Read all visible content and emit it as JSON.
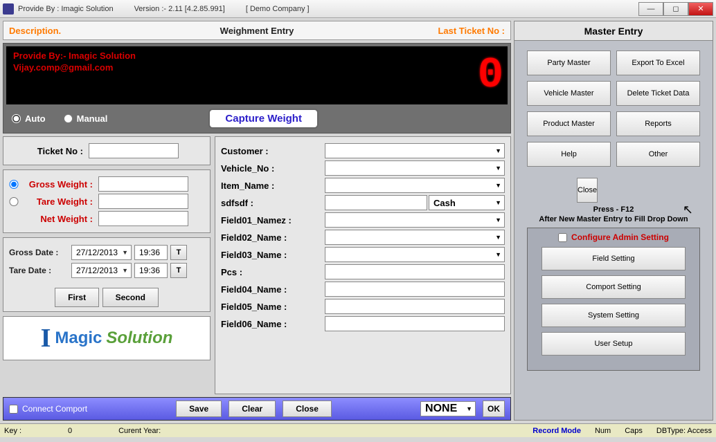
{
  "title": {
    "provider": "Provide By : Imagic Solution",
    "version": "Version :- 2.11 [4.2.85.991]",
    "company": "[ Demo Company ]"
  },
  "header": {
    "desc": "Description.",
    "title": "Weighment Entry",
    "last": "Last Ticket No :"
  },
  "display": {
    "line1": "Provide By:- Imagic Solution",
    "line2": "Vijay.comp@gmail.com",
    "digit": "0"
  },
  "mode": {
    "auto": "Auto",
    "manual": "Manual",
    "capture": "Capture Weight"
  },
  "left": {
    "ticket_lab": "Ticket No :",
    "ticket_val": "",
    "gross_lab": "Gross Weight :",
    "gross_val": "",
    "tare_lab": "Tare Weight  :",
    "tare_val": "",
    "net_lab": "Net Weight :",
    "net_val": "",
    "grossdate_lab": "Gross Date :",
    "taredate_lab": "Tare Date :",
    "date1": "27/12/2013",
    "time1": "19:36",
    "date2": "27/12/2013",
    "time2": "19:36",
    "first": "First",
    "second": "Second",
    "Tbtn": "T"
  },
  "rform": {
    "labels": [
      "Customer :",
      "Vehicle_No :",
      "Item_Name :",
      "sdfsdf :",
      "Field01_Namez :",
      "Field02_Name :",
      "Field03_Name :",
      "Pcs :",
      "Field04_Name :",
      "Field05_Name :",
      "Field06_Name :"
    ],
    "cash": "Cash"
  },
  "action": {
    "connect": "Connect Comport",
    "save": "Save",
    "clear": "Clear",
    "close": "Close",
    "none": "NONE",
    "ok": "OK"
  },
  "right": {
    "title": "Master Entry",
    "btns": [
      "Party Master",
      "Export To Excel",
      "Vehicle Master",
      "Delete Ticket Data",
      "Product Master",
      "Reports",
      "Help",
      "Other"
    ],
    "close": "Close",
    "tip1": "Press - F12",
    "tip2": "After New Master Entry to Fill Drop Down",
    "cfg_title": "Configure Admin Setting",
    "cfg": [
      "Field Setting",
      "Comport Setting",
      "System Setting",
      "User Setup"
    ]
  },
  "status": {
    "key_lab": "Key :",
    "key_val": "0",
    "year_lab": "Curent Year:",
    "mode": "Record Mode",
    "num": "Num",
    "caps": "Caps",
    "db": "DBType: Access"
  },
  "logo": {
    "i": "I",
    "magic": "Magic",
    "sol": "Solution"
  }
}
